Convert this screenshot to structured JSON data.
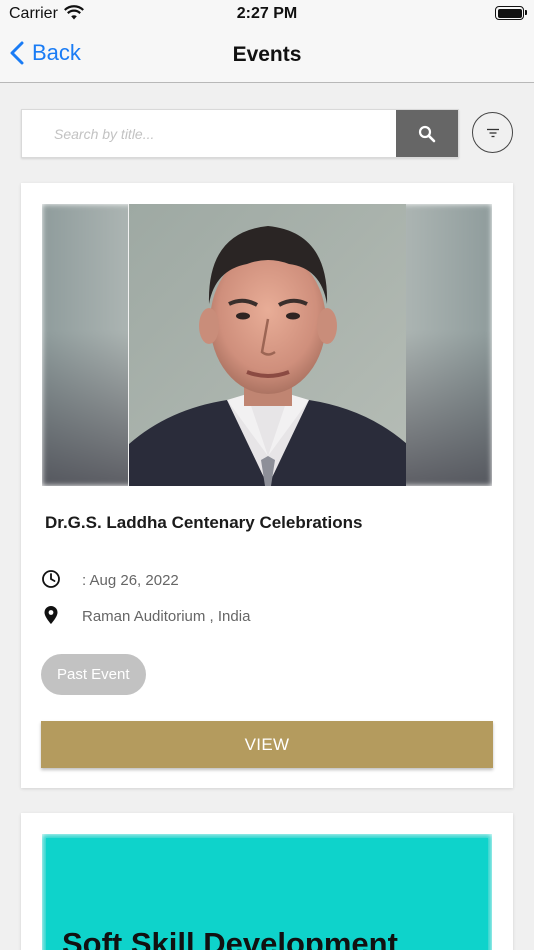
{
  "status_bar": {
    "carrier": "Carrier",
    "time": "2:27 PM"
  },
  "nav": {
    "back_label": "Back",
    "title": "Events"
  },
  "search": {
    "placeholder": "Search by title..."
  },
  "events": [
    {
      "title": "Dr.G.S. Laddha Centenary Celebrations",
      "date": ": Aug 26, 2022",
      "location": "Raman Auditorium , India",
      "status": "Past Event",
      "action_label": "VIEW"
    },
    {
      "banner_text": "Soft Skill Development"
    }
  ],
  "colors": {
    "accent": "#1a7cf5",
    "view_button": "#b49b5e",
    "badge": "#c2c2c2",
    "search_button": "#666666",
    "promo_banner": "#0ed3cb"
  }
}
